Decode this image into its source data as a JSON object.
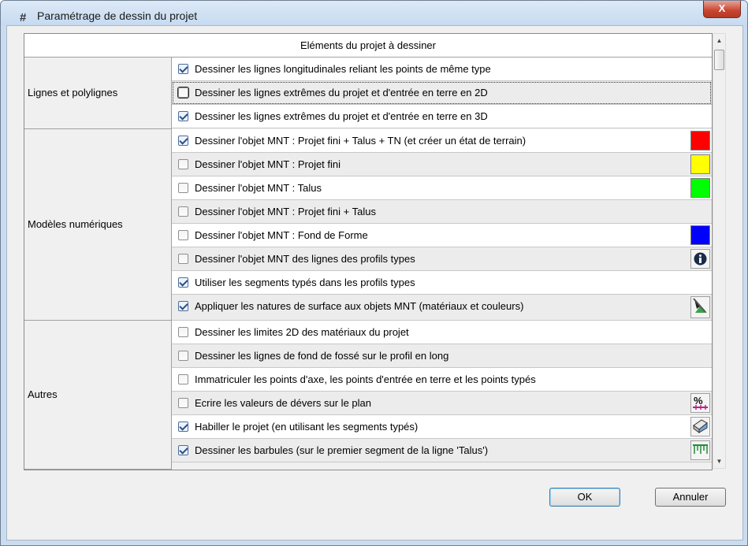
{
  "window": {
    "title": "Paramétrage de dessin du projet",
    "close_label": "X"
  },
  "grid": {
    "header": "Eléments du projet à dessiner",
    "groups": {
      "lignes": "Lignes et polylignes",
      "modeles": "Modèles numériques",
      "autres": "Autres"
    },
    "rows": [
      {
        "label": "Dessiner les lignes longitudinales reliant les points de même type",
        "checked": true,
        "group": "Lignes et polylignes"
      },
      {
        "label": "Dessiner les lignes extrêmes du projet et d'entrée en terre en 2D",
        "checked": false,
        "group": "Lignes et polylignes"
      },
      {
        "label": "Dessiner les lignes extrêmes du projet et d'entrée en terre en 3D",
        "checked": true,
        "group": "Lignes et polylignes"
      },
      {
        "label": "Dessiner l'objet MNT : Projet fini + Talus + TN (et créer un état de terrain)",
        "checked": true,
        "group": "Modèles numériques",
        "color": "#ff0000"
      },
      {
        "label": "Dessiner l'objet MNT : Projet fini",
        "checked": false,
        "group": "Modèles numériques",
        "color": "#ffff00"
      },
      {
        "label": "Dessiner l'objet MNT : Talus",
        "checked": false,
        "group": "Modèles numériques",
        "color": "#00ff00"
      },
      {
        "label": "Dessiner l'objet MNT : Projet fini + Talus",
        "checked": false,
        "group": "Modèles numériques"
      },
      {
        "label": "Dessiner l'objet MNT : Fond de Forme",
        "checked": false,
        "group": "Modèles numériques",
        "color": "#0000ff"
      },
      {
        "label": "Dessiner l'objet MNT des lignes des profils types",
        "checked": false,
        "group": "Modèles numériques",
        "icon": "info-icon"
      },
      {
        "label": "Utiliser les segments typés dans les profils types",
        "checked": true,
        "group": "Modèles numériques"
      },
      {
        "label": "Appliquer les natures de surface aux objets MNT (matériaux et couleurs)",
        "checked": true,
        "group": "Modèles numériques",
        "icon": "surface-material-icon"
      },
      {
        "label": "Dessiner les limites 2D des matériaux du projet",
        "checked": false,
        "group": "Autres"
      },
      {
        "label": "Dessiner les lignes de fond de fossé sur le profil en long",
        "checked": false,
        "group": "Autres"
      },
      {
        "label": "Immatriculer les points d'axe, les points d'entrée en terre et les points typés",
        "checked": false,
        "group": "Autres"
      },
      {
        "label": "Ecrire les valeurs de dévers sur le plan",
        "checked": false,
        "group": "Autres",
        "icon": "percent-devers-icon"
      },
      {
        "label": "Habiller le projet (en utilisant les segments typés)",
        "checked": true,
        "group": "Autres",
        "icon": "dress-project-icon"
      },
      {
        "label": "Dessiner les barbules (sur le premier segment de la ligne 'Talus')",
        "checked": true,
        "group": "Autres",
        "icon": "barbules-icon"
      }
    ]
  },
  "buttons": {
    "ok": "OK",
    "cancel": "Annuler"
  }
}
